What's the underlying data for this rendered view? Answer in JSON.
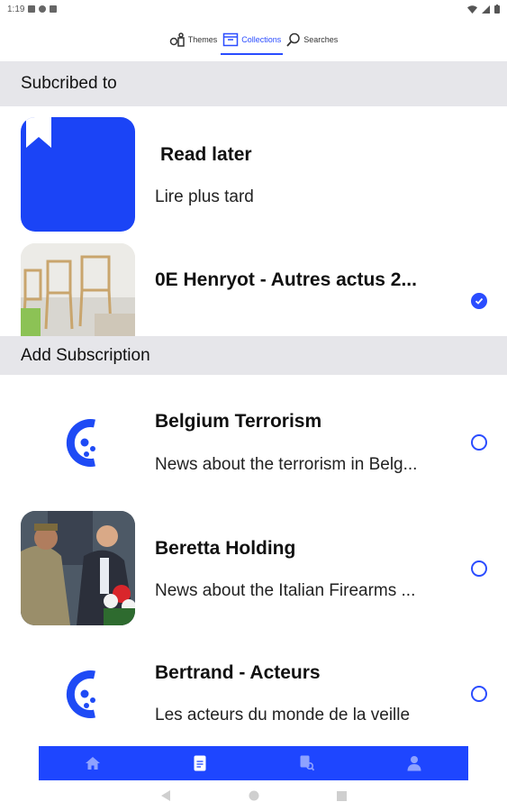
{
  "status": {
    "time": "1:19"
  },
  "tabs": [
    {
      "label": "Themes",
      "icon": "themes-icon"
    },
    {
      "label": "Collections",
      "icon": "collections-icon",
      "active": true
    },
    {
      "label": "Searches",
      "icon": "search-icon"
    }
  ],
  "subscribed": {
    "header": "Subcribed to",
    "items": [
      {
        "title": "Read later",
        "subtitle": "Lire plus tard",
        "icon": "bookmark-icon"
      },
      {
        "title": "0E Henryot - Autres actus 2...",
        "subtitle": "",
        "checked": true
      }
    ]
  },
  "add": {
    "header": "Add Subscription",
    "items": [
      {
        "title": "Belgium Terrorism",
        "subtitle": "News about the terrorism in Belg...",
        "icon": "brand-logo-icon"
      },
      {
        "title": "Beretta Holding",
        "subtitle": "News about the Italian Firearms ..."
      },
      {
        "title": "Bertrand - Acteurs",
        "subtitle": "Les acteurs du monde de la veille",
        "icon": "brand-logo-icon"
      }
    ]
  },
  "bottom_nav": [
    {
      "icon": "home-icon"
    },
    {
      "icon": "document-icon",
      "active": true
    },
    {
      "icon": "search-document-icon"
    },
    {
      "icon": "profile-icon"
    }
  ],
  "colors": {
    "accent": "#2a4cff",
    "nav": "#1e46ff",
    "header_bg": "#e6e6ea"
  }
}
